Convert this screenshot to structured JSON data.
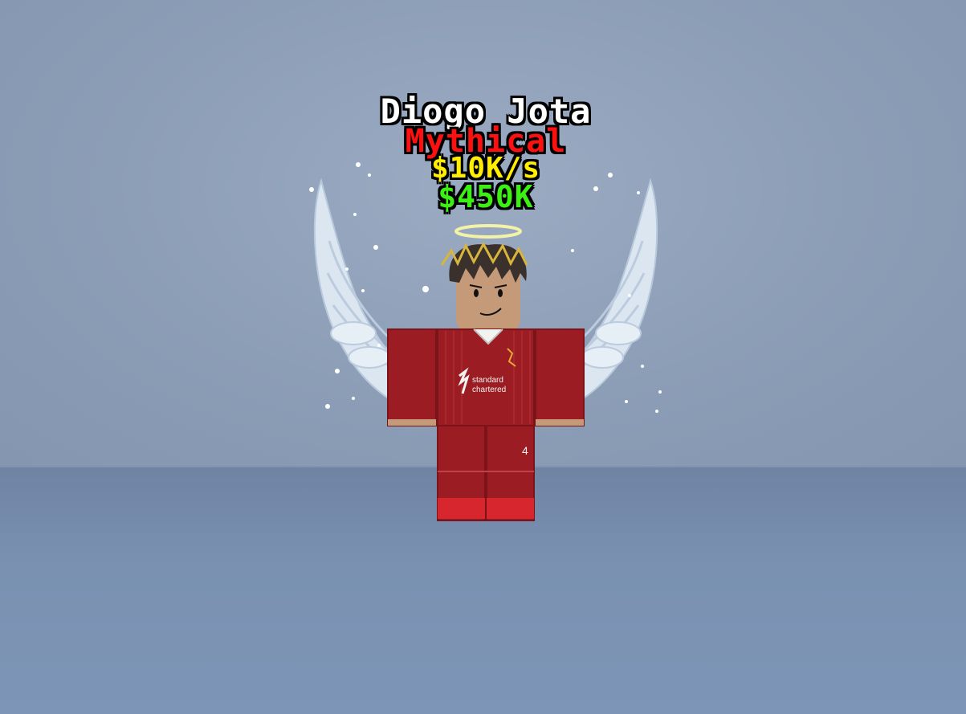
{
  "billboard": {
    "name": "Diogo Jota",
    "rarity": "Mythical",
    "income_rate": "$10K/s",
    "price": "$450K"
  },
  "colors": {
    "name": "#ffffff",
    "rarity": "#ff1010",
    "income_rate": "#ffee00",
    "price": "#3cf014",
    "jersey": "#9b1c22"
  },
  "character": {
    "jersey_sponsor_line1": "standard",
    "jersey_sponsor_line2": "chartered",
    "shorts_number": "4"
  }
}
